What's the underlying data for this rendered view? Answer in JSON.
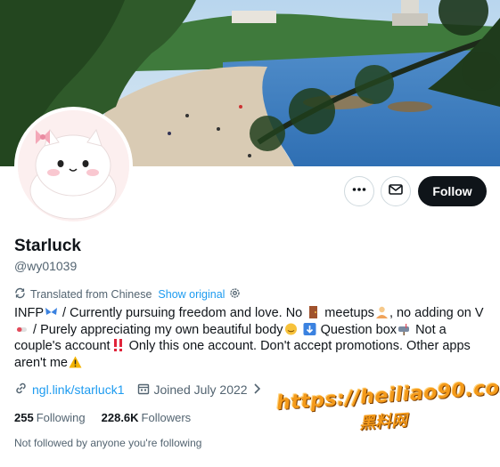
{
  "profile": {
    "display_name": "Starluck",
    "handle": "@wy01039",
    "translated_label": "Translated from Chinese",
    "show_original": "Show original",
    "bio": {
      "line1a": "INFP",
      "line1b": " / Currently pursuing freedom and love. No ",
      "line1c": " meetups",
      "line1d": ", no adding on V",
      "line2a": " / Purely appreciating my own beautiful body",
      "line2b": " Question box",
      "line2c": " Not a",
      "line3a": "couple's account",
      "line3b": " Only this one account. Don't accept promotions. Other apps",
      "line4a": "aren't me"
    },
    "link": "ngl.link/starluck1",
    "joined": "Joined July 2022",
    "following_count": "255",
    "following_label": "Following",
    "followers_count": "228.6K",
    "followers_label": "Followers",
    "not_followed_text": "Not followed by anyone you're following"
  },
  "actions": {
    "follow_label": "Follow",
    "more_icon": "more-icon",
    "message_icon": "message-icon"
  },
  "watermark": {
    "line1": "https://heiliao90.com",
    "line2": "黑料网"
  },
  "colors": {
    "accent": "#1d9bf0",
    "follow_bg": "#0f1419",
    "muted": "#536471"
  }
}
